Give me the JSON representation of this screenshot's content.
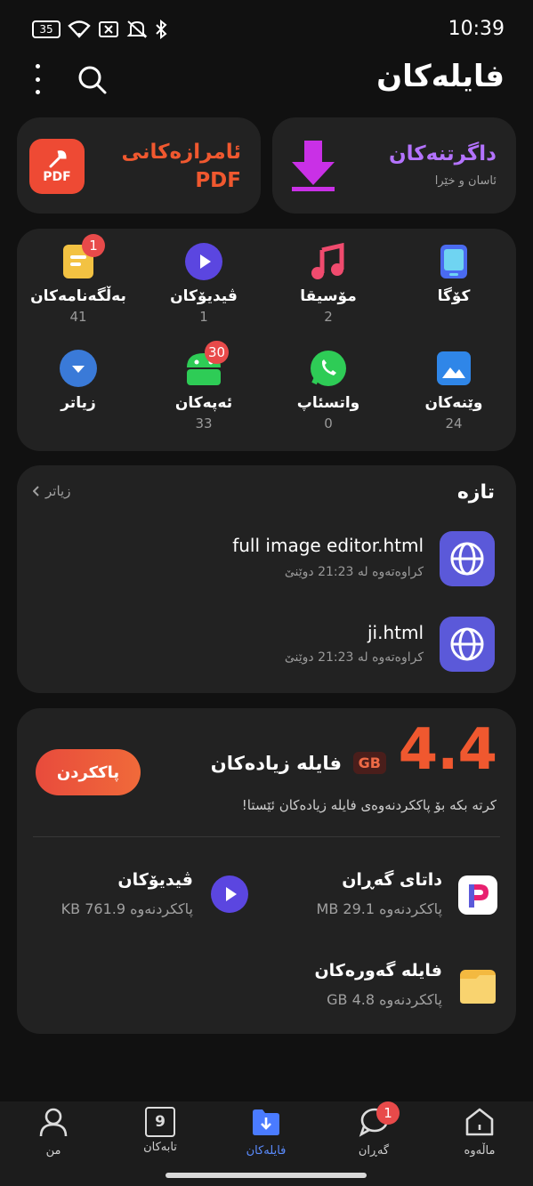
{
  "status_bar": {
    "time": "10:39",
    "battery": "35"
  },
  "header": {
    "title": "فایلەکان"
  },
  "quick_actions": [
    {
      "title": "داگرتنەکان",
      "subtitle": "ئاسان و خێرا"
    },
    {
      "title": "ئامرازەکانی",
      "title2": "PDF",
      "icon_text": "PDF"
    }
  ],
  "categories": [
    {
      "label": "کۆگا",
      "count": ""
    },
    {
      "label": "مۆسیقا",
      "count": "2"
    },
    {
      "label": "ڤیدیۆکان",
      "count": "1"
    },
    {
      "label": "بەڵگەنامەکان",
      "count": "41",
      "badge": "1"
    },
    {
      "label": "وێنەکان",
      "count": "24"
    },
    {
      "label": "واتسئاپ",
      "count": "0"
    },
    {
      "label": "ئەپەکان",
      "count": "33",
      "badge": "30"
    },
    {
      "label": "زیاتر",
      "count": ""
    }
  ],
  "recent": {
    "title": "تازە",
    "more": "زیاتر",
    "items": [
      {
        "name": "full image editor.html",
        "meta": "کراوەتەوە لە 21:23 دوێنێ"
      },
      {
        "name": "ji.html",
        "meta": "کراوەتەوە لە 21:23 دوێنێ"
      }
    ]
  },
  "cleanup": {
    "size": "4.4",
    "unit": "GB",
    "label": "فایلە زیادەکان",
    "description": "کرتە بکە بۆ پاککردنەوەی فایلە زیادەکان ئێستا!",
    "button": "پاککردن",
    "rows": [
      {
        "title": "داتای گەڕان",
        "sub": "پاککردنەوە MB 29.1"
      },
      {
        "title": "ڤیدیۆکان",
        "sub": "پاککردنەوە KB 761.9"
      },
      {
        "title": "فایلە گەورەکان",
        "sub": "پاککردنەوە GB 4.8"
      }
    ]
  },
  "nav": [
    {
      "label": "من"
    },
    {
      "label": "تابەکان",
      "icon_text": "9"
    },
    {
      "label": "فایلەکان"
    },
    {
      "label": "گەڕان",
      "badge": "1"
    },
    {
      "label": "ماڵەوە"
    }
  ],
  "colors": {
    "accent": "#5b59d9",
    "orange": "#f0582f",
    "download": "#c930e6",
    "active_nav": "#5b8cff"
  }
}
